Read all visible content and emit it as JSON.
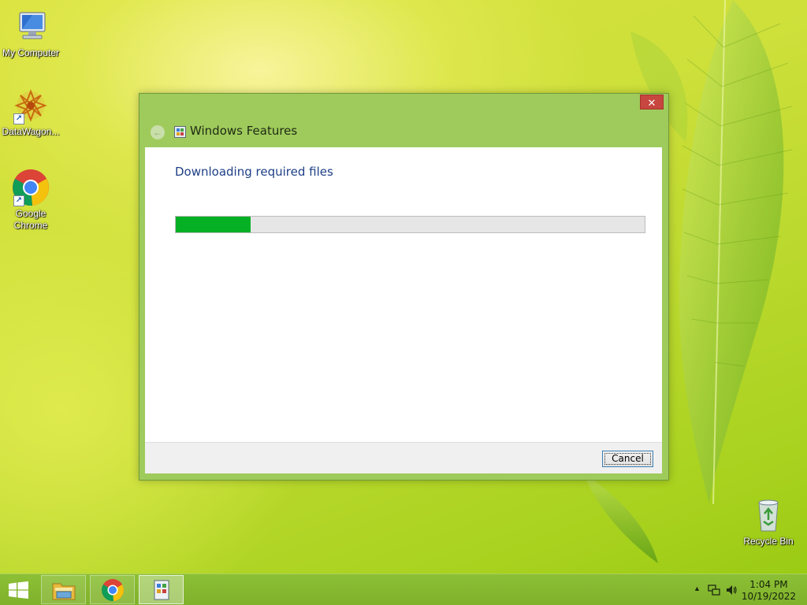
{
  "desktop_icons": [
    {
      "label": "My Computer",
      "icon": "computer-icon"
    },
    {
      "label": "DataWagon...",
      "icon": "datawagon-icon"
    },
    {
      "label": "Google Chrome",
      "icon": "chrome-icon"
    },
    {
      "label": "Recycle Bin",
      "icon": "recycle-bin-icon"
    }
  ],
  "dialog": {
    "title": "Windows Features",
    "close_glyph": "✕",
    "back_glyph": "←",
    "status": "Downloading required files",
    "progress_fraction": 0.16,
    "progress_color": "#06b025",
    "cancel_label": "Cancel"
  },
  "taskbar": {
    "start_icon": "windows-logo-icon",
    "pinned": [
      {
        "name": "file-explorer",
        "icon": "folder-icon"
      },
      {
        "name": "google-chrome",
        "icon": "chrome-icon"
      },
      {
        "name": "windows-features",
        "icon": "windows-features-icon",
        "active": true
      }
    ],
    "tray": {
      "show_hidden_glyph": "▲",
      "time": "1:04 PM",
      "date": "10/19/2022"
    }
  },
  "colors": {
    "window_frame": "#9fcb5c",
    "taskbar": "#86bb30",
    "status_text": "#1e3f86",
    "close_button": "#c7463f"
  }
}
